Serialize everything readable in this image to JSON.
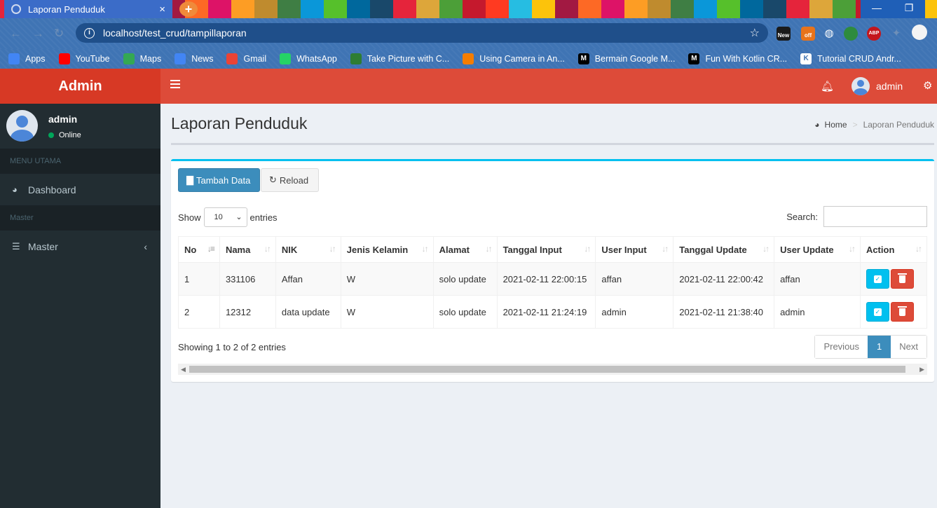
{
  "browser": {
    "tab_title": "Laporan Penduduk",
    "tab_close": "×",
    "new_tab": "+",
    "url": "localhost/test_crud/tampillaporan",
    "star": "☆",
    "window_min": "—",
    "window_restore": "❐",
    "extensions": {
      "new_label": "New",
      "off_label": "off",
      "abp_label": "ABP"
    },
    "bookmarks": [
      {
        "label": "Apps",
        "icon": "apps-grid-icon",
        "color": "#4285f4"
      },
      {
        "label": "YouTube",
        "icon": "youtube-icon",
        "color": "#ff0000"
      },
      {
        "label": "Maps",
        "icon": "maps-icon",
        "color": "#34a853"
      },
      {
        "label": "News",
        "icon": "google-news-icon",
        "color": "#4285f4"
      },
      {
        "label": "Gmail",
        "icon": "gmail-icon",
        "color": "#ea4335"
      },
      {
        "label": "WhatsApp",
        "icon": "whatsapp-icon",
        "color": "#25d366"
      },
      {
        "label": "Take Picture with C...",
        "icon": "site-icon",
        "color": "#2e7d32"
      },
      {
        "label": "Using Camera in An...",
        "icon": "blogger-icon",
        "color": "#f57d00"
      },
      {
        "label": "Bermain Google M...",
        "icon": "medium-icon",
        "color": "#000000"
      },
      {
        "label": "Fun With Kotlin CR...",
        "icon": "medium-icon",
        "color": "#000000"
      },
      {
        "label": "Tutorial CRUD Andr...",
        "icon": "k-site-icon",
        "color": "#ffffff"
      }
    ]
  },
  "app": {
    "brand": "Admin",
    "user_name": "admin",
    "user_status": "Online",
    "menu_header_main": "MENU UTAMA",
    "menu_dashboard": "Dashboard",
    "menu_header_master": "Master",
    "menu_master": "Master",
    "top_user": "admin",
    "colors": {
      "header": "#dd4b39",
      "logo": "#d73925",
      "sidebar": "#222d32",
      "primary": "#3c8dbc",
      "info": "#00c0ef",
      "danger": "#dd4b39"
    }
  },
  "page": {
    "title": "Laporan Penduduk",
    "breadcrumb_home": "Home",
    "breadcrumb_current": "Laporan Penduduk",
    "btn_add": "Tambah Data",
    "btn_reload": "Reload",
    "show_label": "Show",
    "entries_label": "entries",
    "page_length": "10",
    "search_label": "Search:",
    "search_value": "",
    "info": "Showing 1 to 2 of 2 entries",
    "pager_prev": "Previous",
    "pager_current": "1",
    "pager_next": "Next"
  },
  "table": {
    "headers": [
      "No",
      "Nama",
      "NIK",
      "Jenis Kelamin",
      "Alamat",
      "Tanggal Input",
      "User Input",
      "Tanggal Update",
      "User Update",
      "Action"
    ],
    "rows": [
      [
        "1",
        "331106",
        "Affan",
        "W",
        "solo update",
        "2021-02-11 22:00:15",
        "affan",
        "2021-02-11 22:00:42",
        "affan"
      ],
      [
        "2",
        "12312",
        "data update",
        "W",
        "solo update",
        "2021-02-11 21:24:19",
        "admin",
        "2021-02-11 21:38:40",
        "admin"
      ]
    ]
  }
}
